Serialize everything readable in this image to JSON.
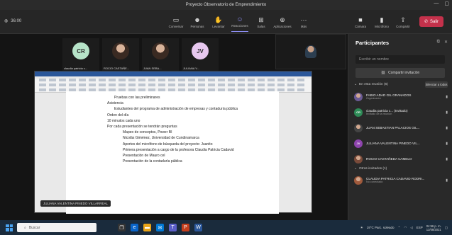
{
  "window": {
    "title": "Proyecto Observatorio de Emprendimiento"
  },
  "toolbar": {
    "timer": "36:00",
    "buttons": [
      {
        "icon": "chat-icon",
        "label": "Conversar"
      },
      {
        "icon": "people-icon",
        "label": "Personas"
      },
      {
        "icon": "hand-icon",
        "label": "Levantar"
      },
      {
        "icon": "reactions-icon",
        "label": "Reacciones"
      },
      {
        "icon": "rooms-icon",
        "label": "Salas"
      },
      {
        "icon": "apps-icon",
        "label": "Aplicaciones"
      },
      {
        "icon": "more-icon",
        "label": "Más"
      }
    ],
    "media_buttons": [
      {
        "icon": "camera-icon",
        "label": "Cámara"
      },
      {
        "icon": "mic-icon",
        "label": "Micrófono"
      },
      {
        "icon": "share-icon",
        "label": "Compartir"
      }
    ],
    "leave_label": "Salir"
  },
  "tiles": [
    {
      "initials": "CR",
      "color": "#b6e3c8",
      "name": "claudia patricia c..."
    },
    {
      "initials": "",
      "color": "",
      "name": "ROCIO CASTAÑE..."
    },
    {
      "initials": "",
      "color": "",
      "name": "JUAN SEBA..."
    },
    {
      "initials": "JV",
      "color": "#e7c8ef",
      "name": "JULIANA V..."
    }
  ],
  "document": {
    "lines": [
      {
        "text": "Pruebas con las preliminares",
        "level": 1
      },
      {
        "text": "Asistencia",
        "level": 0
      },
      {
        "text": "Estudiantes del programa de administración de empresas y contaduría pública",
        "level": 1
      },
      {
        "text": "Orden del día",
        "level": 0
      },
      {
        "text": "10 minutos cada uno",
        "level": 0
      },
      {
        "text": "Por cada presentación se tendrán preguntas",
        "level": 0
      },
      {
        "text": "Mapeo de conceptos, Power BI",
        "level": 2
      },
      {
        "text": "Nicolás Giménez, Universidad de Cundinamarca",
        "level": 2
      },
      {
        "text": "Aportes del micrófono de búsqueda del proyecto: Juanito",
        "level": 2
      },
      {
        "text": "Primera presentación a cargo de la profesora Claudia Patricia Cadavid",
        "level": 2
      },
      {
        "text": "Presentación de Mauro cel",
        "level": 2
      },
      {
        "text": "Presentación de la contaduría pública",
        "level": 2
      }
    ],
    "presenter_label": "JULIANA VALENTINA PINEDO VILLARREAL"
  },
  "panel": {
    "title": "Participantes",
    "search_placeholder": "Escribir un nombre",
    "share_invite": "Compartir invitación",
    "in_meeting": "En esta reunión (6)",
    "mute_all": "Silenciar a todos",
    "others": "Otros invitados (1)",
    "participants": [
      {
        "initials": "",
        "photo": true,
        "color": "#6b5b95",
        "name": "FABIO ADAD GIL GRANADOS",
        "sub": "Organizador"
      },
      {
        "initials": "CR",
        "photo": false,
        "color": "#2e8b57",
        "name": "claudia patricia c... (Invitado)",
        "sub": "Invitado de la reunión"
      },
      {
        "initials": "",
        "photo": true,
        "color": "#444",
        "name": "JUAN SEBASTIAN PALACIOS GIL...",
        "sub": ""
      },
      {
        "initials": "JV",
        "photo": false,
        "color": "#8e44ad",
        "name": "JULIANA VALENTINA PINEDO VIL...",
        "sub": ""
      },
      {
        "initials": "",
        "photo": true,
        "color": "#7a4b3a",
        "name": "ROCIO CASTAÑEDA CAMELO",
        "sub": ""
      }
    ],
    "other_participants": [
      {
        "initials": "",
        "photo": true,
        "color": "#a05a3c",
        "name": "CLAUDIA PATRICIA CADAVID RODRI...",
        "sub": "No conectado"
      }
    ]
  },
  "taskbar": {
    "search_placeholder": "Buscar",
    "weather": "19°C Parc. soleado",
    "lang": "ESP",
    "time": "04:56 p. m.",
    "date": "12/08/2021"
  }
}
